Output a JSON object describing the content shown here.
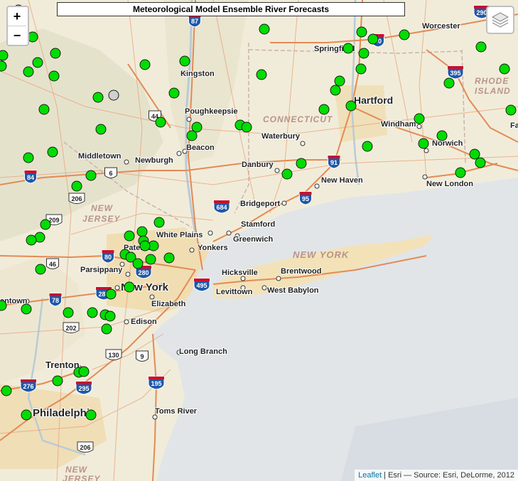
{
  "title": "Meteorological Model Ensemble River Forecasts",
  "zoom": {
    "in_label": "+",
    "out_label": "−"
  },
  "layers_icon": "layers-icon",
  "attribution": {
    "link": "Leaflet",
    "text": " | Esri — Source: Esri, DeLorme, 2012"
  },
  "colors": {
    "marker": "#00dd00",
    "marker_inactive": "#d0d0d0",
    "water": "#e1e5e8",
    "land": "#f1ecd9",
    "road": "#e8a077",
    "interstate": "#1f58a8"
  },
  "cities": [
    {
      "name": "Worcester",
      "size": 11
    },
    {
      "name": "Springfield",
      "size": 11
    },
    {
      "name": "Kingston",
      "size": 11
    },
    {
      "name": "Hartford",
      "size": 14
    },
    {
      "name": "Poughkeepsie",
      "size": 11
    },
    {
      "name": "Windham",
      "size": 11
    },
    {
      "name": "Waterbury",
      "size": 11
    },
    {
      "name": "Norwich",
      "size": 11
    },
    {
      "name": "Beacon",
      "size": 11
    },
    {
      "name": "Middletown",
      "size": 11
    },
    {
      "name": "Newburgh",
      "size": 11
    },
    {
      "name": "Danbury",
      "size": 11
    },
    {
      "name": "New Haven",
      "size": 11
    },
    {
      "name": "New London",
      "size": 11
    },
    {
      "name": "Bridgeport",
      "size": 11
    },
    {
      "name": "Stamford",
      "size": 11
    },
    {
      "name": "White Plains",
      "size": 11
    },
    {
      "name": "Greenwich",
      "size": 11
    },
    {
      "name": "Paterson",
      "size": 11
    },
    {
      "name": "Yonkers",
      "size": 11
    },
    {
      "name": "Parsippany",
      "size": 11
    },
    {
      "name": "Hicksville",
      "size": 11
    },
    {
      "name": "Brentwood",
      "size": 11
    },
    {
      "name": "New York",
      "size": 15
    },
    {
      "name": "Levittown",
      "size": 11
    },
    {
      "name": "West Babylon",
      "size": 11
    },
    {
      "name": "entown",
      "size": 11
    },
    {
      "name": "Elizabeth",
      "size": 11
    },
    {
      "name": "Edison",
      "size": 11
    },
    {
      "name": "Long Branch",
      "size": 11
    },
    {
      "name": "Trenton",
      "size": 13
    },
    {
      "name": "Philadelphia",
      "size": 15
    },
    {
      "name": "Toms River",
      "size": 11
    },
    {
      "name": "Fa",
      "size": 11
    }
  ],
  "states": [
    {
      "name": "CONNECTICUT"
    },
    {
      "name": "RHODE"
    },
    {
      "name": "ISLAND"
    },
    {
      "name": "NEW"
    },
    {
      "name": "JERSEY"
    },
    {
      "name": "NEW YORK"
    },
    {
      "name": "NEW"
    },
    {
      "name": "JERSEY"
    }
  ],
  "shields": [
    {
      "label": "87",
      "type": "interstate"
    },
    {
      "label": "90",
      "type": "interstate"
    },
    {
      "label": "290",
      "type": "interstate"
    },
    {
      "label": "395",
      "type": "interstate"
    },
    {
      "label": "44",
      "type": "us"
    },
    {
      "label": "84",
      "type": "interstate"
    },
    {
      "label": "6",
      "type": "us"
    },
    {
      "label": "91",
      "type": "interstate"
    },
    {
      "label": "206",
      "type": "us"
    },
    {
      "label": "684",
      "type": "interstate"
    },
    {
      "label": "95",
      "type": "interstate"
    },
    {
      "label": "209",
      "type": "us"
    },
    {
      "label": "80",
      "type": "interstate"
    },
    {
      "label": "46",
      "type": "us"
    },
    {
      "label": "280",
      "type": "interstate"
    },
    {
      "label": "287",
      "type": "interstate"
    },
    {
      "label": "495",
      "type": "interstate"
    },
    {
      "label": "78",
      "type": "interstate"
    },
    {
      "label": "202",
      "type": "us"
    },
    {
      "label": "130",
      "type": "us"
    },
    {
      "label": "9",
      "type": "us"
    },
    {
      "label": "276",
      "type": "interstate"
    },
    {
      "label": "295",
      "type": "interstate"
    },
    {
      "label": "195",
      "type": "interstate"
    },
    {
      "label": "206",
      "type": "us"
    }
  ]
}
